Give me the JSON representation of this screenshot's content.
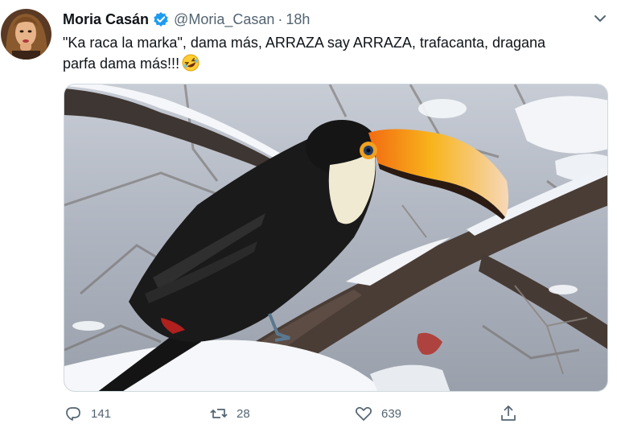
{
  "tweet": {
    "display_name": "Moria Casán",
    "handle": "@Moria_Casan",
    "separator": "·",
    "timestamp": "18h",
    "text_line1": "\"Ka raca la marka\", dama más, ARRAZA say ARRAZA, trafacanta, dragana",
    "text_line2": "parfa dama más!!!",
    "emoji": "rolling-on-floor-laughing-emoji"
  },
  "actions": {
    "reply_count": "141",
    "retweet_count": "28",
    "like_count": "639"
  },
  "icons": {
    "verified": "verified-badge-icon",
    "caret": "chevron-down-icon",
    "reply": "reply-icon",
    "retweet": "retweet-icon",
    "like": "heart-icon",
    "share": "share-icon"
  },
  "colors": {
    "text": "#0f1419",
    "secondary": "#536471",
    "verified": "#1d9bf0",
    "beak_orange": "#f39a1c"
  }
}
